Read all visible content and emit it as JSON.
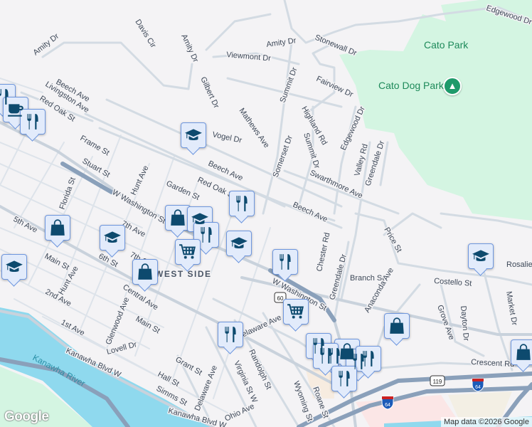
{
  "map": {
    "labels": [
      "Amity Dr",
      "Davis Cir",
      "Amity Dr",
      "Viewmont Dr",
      "Gilbert Dr",
      "Mathews Ave",
      "Beech Ave",
      "Livingston Ave",
      "Red Oak St",
      "Frame St",
      "Stuart St",
      "Hunt Ave",
      "Florida St",
      "Vogel Dr",
      "Beech Ave",
      "Red Oak St",
      "Garden St",
      "W Washington St",
      "Stonewall Dr",
      "Amity Dr",
      "Fairview Dr",
      "Summit Dr",
      "Highland Rd",
      "Summit Dr",
      "Somerset Dr",
      "Edgewood Dr",
      "Valley Rd",
      "Greendale Dr",
      "Swarthmore Ave",
      "Beech Ave",
      "Edgewood Dr",
      "Cato Park",
      "Cato Dog Park",
      "5th Ave",
      "Main St",
      "6th St",
      "7th Ave",
      "7th St",
      "Hunt Ave",
      "2nd Ave",
      "1st Ave",
      "Central Ave",
      "Main St",
      "Glenwood Ave",
      "Lovell Dr",
      "Kanawha Blvd W",
      "Kanawha River",
      "Grant St",
      "Hall St",
      "Simms St",
      "Delaware Ave",
      "Kanawha Blvd W",
      "Ohio Ave",
      "Virginia St W",
      "Randolph St",
      "Delaware Ave",
      "Chester Rd",
      "Greendale Dr",
      "Branch St",
      "Anaconda Ave",
      "Price St",
      "Costello St",
      "Grove Ave",
      "Dayton Dr",
      "Market Dr",
      "Rosalie",
      "Crescent Rd",
      "Wyoming St",
      "Roane St",
      "W Washington St",
      "WEST SIDE"
    ],
    "shields": [
      "60",
      "119",
      "64",
      "64"
    ],
    "markers": [
      "restaurant",
      "coffee",
      "restaurant",
      "school",
      "restaurant",
      "shopping",
      "school",
      "restaurant",
      "school",
      "shopping",
      "school",
      "school",
      "shopping",
      "cart",
      "restaurant",
      "cart",
      "restaurant",
      "restaurant",
      "restaurant",
      "shopping",
      "restaurant",
      "restaurant",
      "restaurant",
      "restaurant",
      "shopping",
      "school",
      "shopping"
    ],
    "park_icon": "tree-icon",
    "attribution": "Map data ©2026 Google",
    "logo": "Google",
    "colors": {
      "park": "#d4f5e2",
      "water": "#8fd9ee",
      "marker_fill": "#e2ebfb",
      "icon": "#0d4a6e",
      "highway": "#8aa0ba"
    }
  }
}
